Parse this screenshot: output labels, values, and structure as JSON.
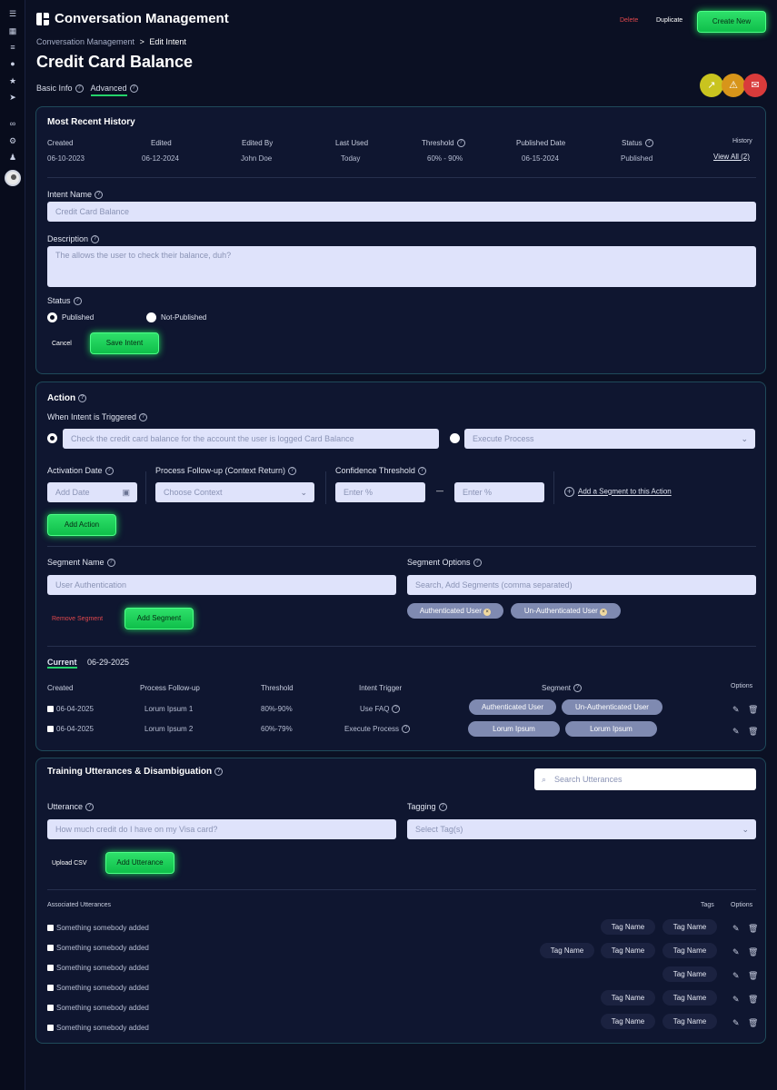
{
  "app": {
    "title": "Conversation Management"
  },
  "top_actions": {
    "delete": "Delete",
    "duplicate": "Duplicate",
    "create_new": "Create New"
  },
  "breadcrumb": {
    "parent": "Conversation Management",
    "sep": ">",
    "current": "Edit Intent"
  },
  "page_title": "Credit Card Balance",
  "tabs": [
    {
      "label": "Basic Info"
    },
    {
      "label": "Advanced"
    }
  ],
  "status_icons": [
    {
      "icon": "trend-icon",
      "color": "#c9c41f"
    },
    {
      "icon": "warning-icon",
      "color": "#d7951a"
    },
    {
      "icon": "message-icon",
      "color": "#d93b3b"
    }
  ],
  "history": {
    "title": "Most Recent History",
    "columns": [
      "Created",
      "Edited",
      "Edited By",
      "Last Used",
      "Threshold",
      "Published Date",
      "Status",
      "History"
    ],
    "values": [
      "06-10-2023",
      "06-12-2024",
      "John Doe",
      "Today",
      "60% - 90%",
      "06-15-2024",
      "Published",
      "View All (2)"
    ]
  },
  "intent": {
    "name_label": "Intent Name",
    "name_value": "Credit Card Balance",
    "desc_label": "Description",
    "desc_value": "The allows the user to check their balance, duh?",
    "status_label": "Status",
    "status_options": [
      "Published",
      "Not-Published"
    ],
    "cancel": "Cancel",
    "save": "Save Intent"
  },
  "action": {
    "title": "Action",
    "trigger_label": "When Intent is Triggered",
    "trigger_text": "Check the credit card balance for the account the user is logged  Card Balance",
    "process_select": "Execute Process",
    "activation_label": "Activation Date",
    "activation_placeholder": "Add Date",
    "followup_label": "Process Follow-up (Context Return)",
    "followup_placeholder": "Choose Context",
    "confidence_label": "Confidence Threshold",
    "conf_min": "Enter %",
    "conf_dash": "—",
    "conf_max": "Enter %",
    "add_segment_link": "Add a Segment to this Action",
    "add_action": "Add Action",
    "segment_name_label": "Segment Name",
    "segment_name_placeholder": "User Authentication",
    "segment_options_label": "Segment Options",
    "segment_options_placeholder": "Search, Add Segments (comma separated)",
    "segment_chips": [
      "Authenticated User",
      "Un-Authenticated User"
    ],
    "remove_segment": "Remove Segment",
    "add_segment": "Add Segment",
    "current_label": "Current",
    "current_date": "06-29-2025",
    "table_headers": [
      "Created",
      "Process Follow-up",
      "Threshold",
      "Intent Trigger",
      "Segment",
      "Options"
    ],
    "rows": [
      {
        "created": "06-04-2025",
        "followup": "Lorum Ipsum 1",
        "threshold": "80%-90%",
        "trigger": "Use FAQ",
        "segments": [
          "Authenticated User",
          "Un-Authenticated User"
        ]
      },
      {
        "created": "06-04-2025",
        "followup": "Lorum Ipsum 2",
        "threshold": "60%-79%",
        "trigger": "Execute Process",
        "segments": [
          "Lorum Ipsum",
          "Lorum Ipsum"
        ]
      }
    ]
  },
  "training": {
    "title": "Training Utterances & Disambiguation",
    "search_placeholder": "Search Utterances",
    "utterance_label": "Utterance",
    "utterance_placeholder": "How much credit do I have on my Visa card?",
    "tagging_label": "Tagging",
    "tagging_placeholder": "Select Tag(s)",
    "upload_csv": "Upload CSV",
    "add_utterance": "Add Utterance",
    "assoc_label": "Associated Utterances",
    "tags_header": "Tags",
    "options_header": "Options",
    "rows": [
      {
        "text": "Something somebody added",
        "tags": [
          "Tag Name",
          "Tag Name"
        ]
      },
      {
        "text": "Something somebody added",
        "tags": [
          "Tag Name",
          "Tag Name",
          "Tag Name"
        ]
      },
      {
        "text": "Something somebody added",
        "tags": [
          "Tag Name"
        ]
      },
      {
        "text": "Something somebody added",
        "tags": [
          "Tag Name",
          "Tag Name"
        ]
      },
      {
        "text": "Something somebody added",
        "tags": []
      },
      {
        "text": "Something somebody added",
        "tags": [
          "Tag Name",
          "Tag Name"
        ]
      }
    ]
  }
}
